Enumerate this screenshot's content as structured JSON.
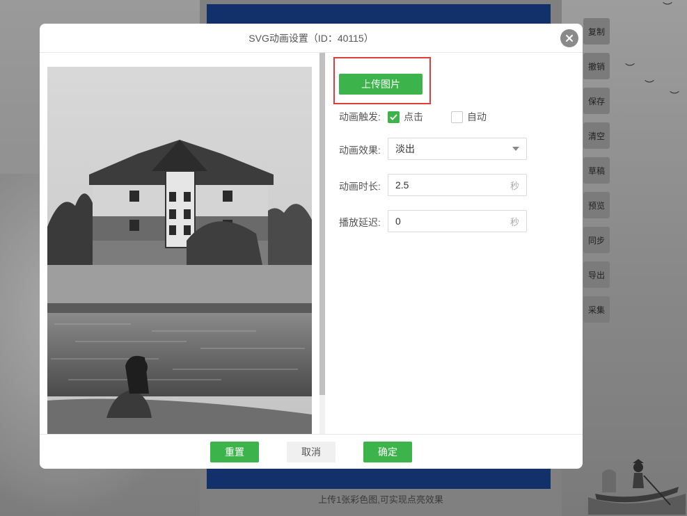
{
  "background": {
    "caption": "上传1张彩色图,可实现点亮效果",
    "toolbar": [
      "复制",
      "撤销",
      "保存",
      "清空",
      "草稿",
      "预览",
      "同步",
      "导出",
      "采集"
    ]
  },
  "modal": {
    "title": "SVG动画设置（ID：40115）",
    "upload_label": "上传图片",
    "trigger": {
      "label": "动画触发:",
      "options": [
        {
          "label": "点击",
          "checked": true
        },
        {
          "label": "自动",
          "checked": false
        }
      ]
    },
    "effect": {
      "label": "动画效果:",
      "value": "淡出"
    },
    "duration": {
      "label": "动画时长:",
      "value": "2.5",
      "unit": "秒"
    },
    "delay": {
      "label": "播放延迟:",
      "value": "0",
      "unit": "秒"
    },
    "footer": {
      "reset": "重置",
      "cancel": "取消",
      "confirm": "确定"
    }
  },
  "colors": {
    "accent": "#3cb44b",
    "highlight": "#e03a3a",
    "canvas": "#12306a"
  }
}
